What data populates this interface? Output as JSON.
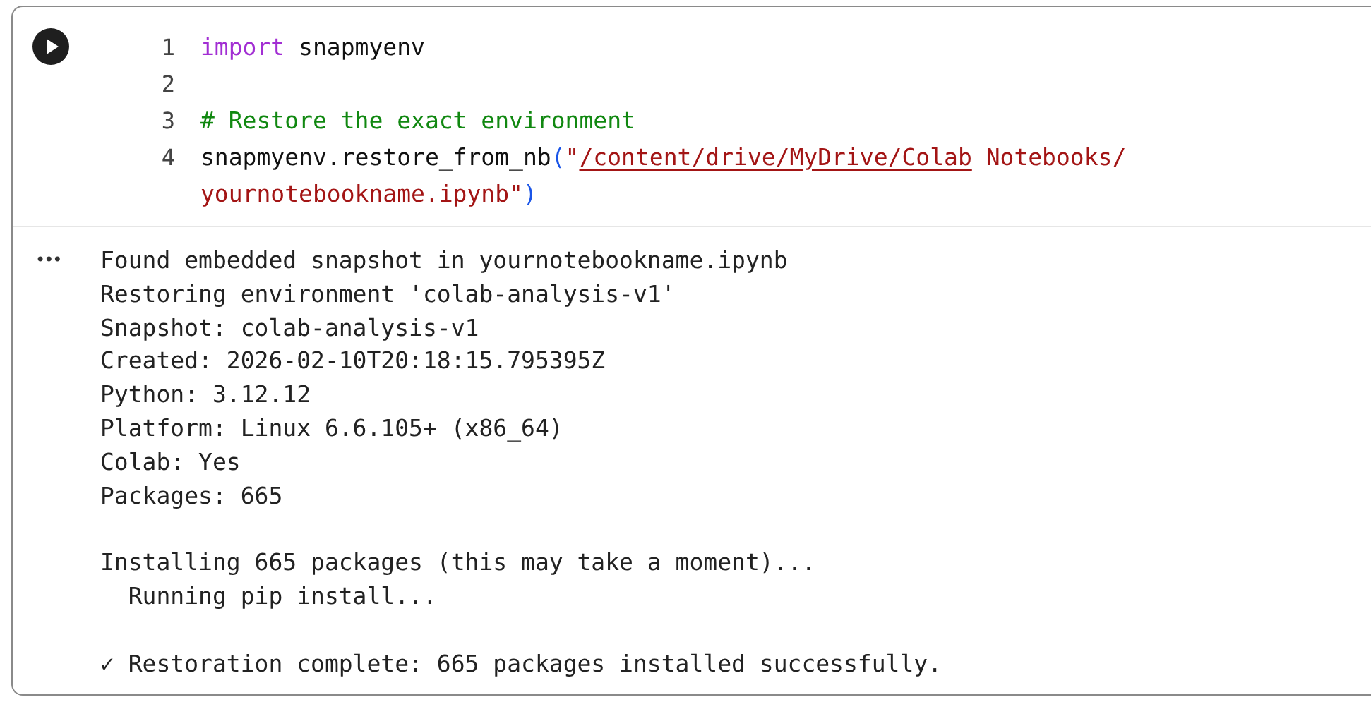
{
  "code_cell": {
    "lines": [
      {
        "number": "1",
        "tokens": [
          {
            "kind": "keyword",
            "text": "import"
          },
          {
            "kind": "plain",
            "text": " snapmyenv"
          }
        ]
      },
      {
        "number": "2"
      },
      {
        "number": "3",
        "tokens": [
          {
            "kind": "comment",
            "text": "# Restore the exact environment"
          }
        ]
      },
      {
        "number": "4",
        "tokens": [
          {
            "kind": "plain",
            "text": "snapmyenv.restore_from_nb"
          },
          {
            "kind": "paren",
            "text": "("
          },
          {
            "kind": "string",
            "text": "\""
          },
          {
            "kind": "link",
            "text": "/content/drive/MyDrive/Colab"
          },
          {
            "kind": "string",
            "text": " Notebooks/"
          }
        ]
      },
      {
        "tokens": [
          {
            "kind": "string",
            "text": "yournotebookname.ipynb\""
          },
          {
            "kind": "paren",
            "text": ")"
          }
        ]
      }
    ]
  },
  "output": {
    "marker": "•••",
    "blocks": [
      [
        "Found embedded snapshot in yournotebookname.ipynb",
        "Restoring environment 'colab-analysis-v1'",
        "Snapshot: colab-analysis-v1",
        "Created: 2026-02-10T20:18:15.795395Z",
        "Python: 3.12.12",
        "Platform: Linux 6.6.105+ (x86_64)",
        "Colab: Yes",
        "Packages: 665"
      ],
      [
        "Installing 665 packages (this may take a moment)...",
        "  Running pip install..."
      ],
      [
        "✓ Restoration complete: 665 packages installed successfully."
      ]
    ]
  }
}
